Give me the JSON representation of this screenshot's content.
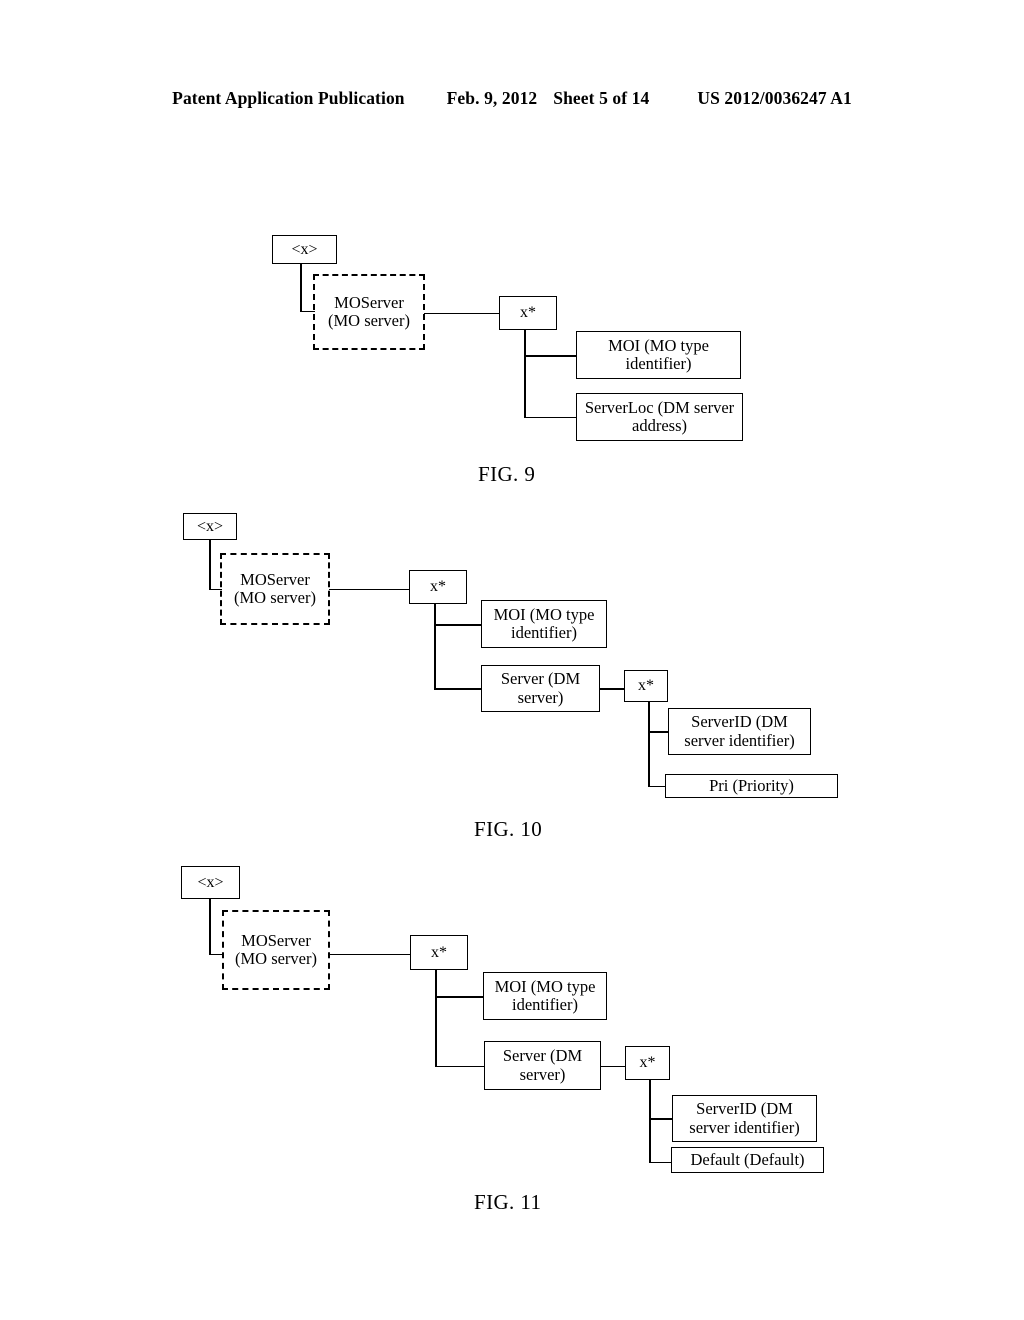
{
  "header": {
    "publication": "Patent Application Publication",
    "date": "Feb. 9, 2012",
    "sheet": "Sheet 5 of 14",
    "patent_number": "US 2012/0036247 A1"
  },
  "figures": [
    {
      "caption": "FIG. 9",
      "nodes": {
        "root": "<x>",
        "moserver": "MOServer\n(MO server)",
        "xstar": "x*",
        "moi": "MOI (MO type\nidentifier)",
        "serverloc": "ServerLoc (DM server\naddress)"
      }
    },
    {
      "caption": "FIG. 10",
      "nodes": {
        "root": "<x>",
        "moserver": "MOServer\n(MO server)",
        "xstar": "x*",
        "moi": "MOI (MO type\nidentifier)",
        "server": "Server (DM\nserver)",
        "xstar2": "x*",
        "serverid": "ServerID (DM\nserver identifier)",
        "leaf": "Pri (Priority)"
      }
    },
    {
      "caption": "FIG. 11",
      "nodes": {
        "root": "<x>",
        "moserver": "MOServer\n(MO server)",
        "xstar": "x*",
        "moi": "MOI (MO type\nidentifier)",
        "server": "Server (DM\nserver)",
        "xstar2": "x*",
        "serverid": "ServerID (DM\nserver identifier)",
        "leaf": "Default (Default)"
      }
    }
  ]
}
